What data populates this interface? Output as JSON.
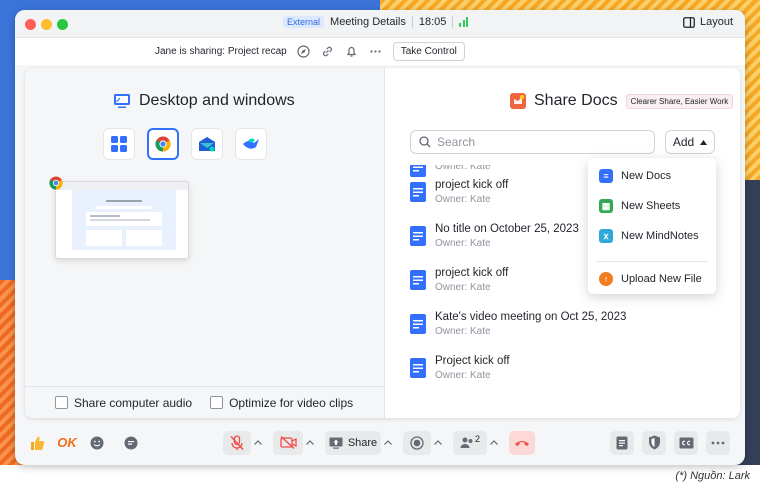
{
  "window": {
    "badge": "External",
    "title": "Meeting Details",
    "time": "18:05",
    "layout_label": "Layout"
  },
  "sharebar": {
    "status": "Jane is sharing: Project recap",
    "take_control": "Take Control"
  },
  "left_panel": {
    "title": "Desktop and windows",
    "sources": [
      "apps-grid-icon",
      "chrome-icon",
      "lark-mail-icon",
      "lark-icon"
    ],
    "share_audio_label": "Share computer audio",
    "optimize_label": "Optimize for video clips"
  },
  "right_panel": {
    "title": "Share Docs",
    "tag": "Clearer Share, Easier Work",
    "search_placeholder": "Search",
    "add_label": "Add",
    "docs": [
      {
        "title": "",
        "owner": "Owner: Kate"
      },
      {
        "title": "project kick off",
        "owner": "Owner: Kate"
      },
      {
        "title": "No title on October 25, 2023",
        "owner": "Owner: Kate"
      },
      {
        "title": "project kick off",
        "owner": "Owner: Kate"
      },
      {
        "title": "Kate's video meeting on Oct 25, 2023",
        "owner": "Owner: Kate"
      },
      {
        "title": "Project kick off",
        "owner": "Owner: Kate"
      }
    ]
  },
  "add_menu": {
    "items": [
      "New Docs",
      "New Sheets",
      "New MindNotes",
      "Upload New File"
    ]
  },
  "toolbar": {
    "ok_label": "OK",
    "share_label": "Share",
    "participants_count": "2"
  },
  "credit": "(*) Nguồn: Lark",
  "colors": {
    "accent": "#3370ff",
    "danger": "#f54a45",
    "signal": "#34c759"
  }
}
